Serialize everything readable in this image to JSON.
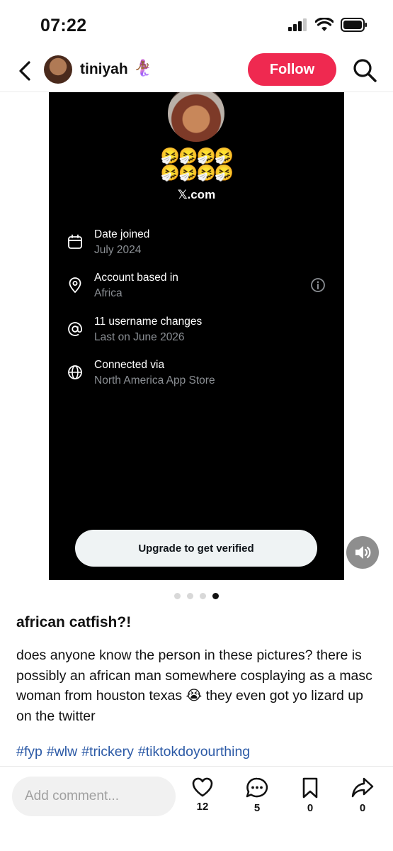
{
  "status_bar": {
    "time": "07:22"
  },
  "header": {
    "username": "tiniyah",
    "username_emoji": "🧜🏾‍♀️",
    "follow_label": "Follow"
  },
  "media": {
    "emoji_row_1": "🤧🤧🤧🤧",
    "emoji_row_2": "🤧🤧🤧🤧",
    "site": "𝕏.com",
    "info": [
      {
        "icon": "calendar-icon",
        "title": "Date joined",
        "subtitle": "July 2024"
      },
      {
        "icon": "location-pin-icon",
        "title": "Account based in",
        "subtitle": "Africa"
      },
      {
        "icon": "at-sign-icon",
        "title": "11 username changes",
        "subtitle": "Last on June 2026"
      },
      {
        "icon": "globe-icon",
        "title": "Connected via",
        "subtitle": "North America App Store"
      }
    ],
    "upgrade_label": "Upgrade to get verified",
    "pagination": {
      "total": 4,
      "active_index": 3
    }
  },
  "post": {
    "title": "african catfish?!",
    "body": "does anyone know the person in these pictures? there is possibly an african man somewhere cosplaying as a masc woman from houston texas 😭 they even got yo lizard up on the twitter",
    "hashtags": [
      "#fyp",
      "#wlw",
      "#trickery",
      "#tiktokdoyourthing"
    ]
  },
  "bottom_bar": {
    "comment_placeholder": "Add comment...",
    "likes": "12",
    "comments": "5",
    "saves": "0",
    "shares": "0"
  },
  "colors": {
    "follow_button": "#ef2950",
    "hashtag": "#2c5aa6",
    "media_background": "#000000"
  }
}
